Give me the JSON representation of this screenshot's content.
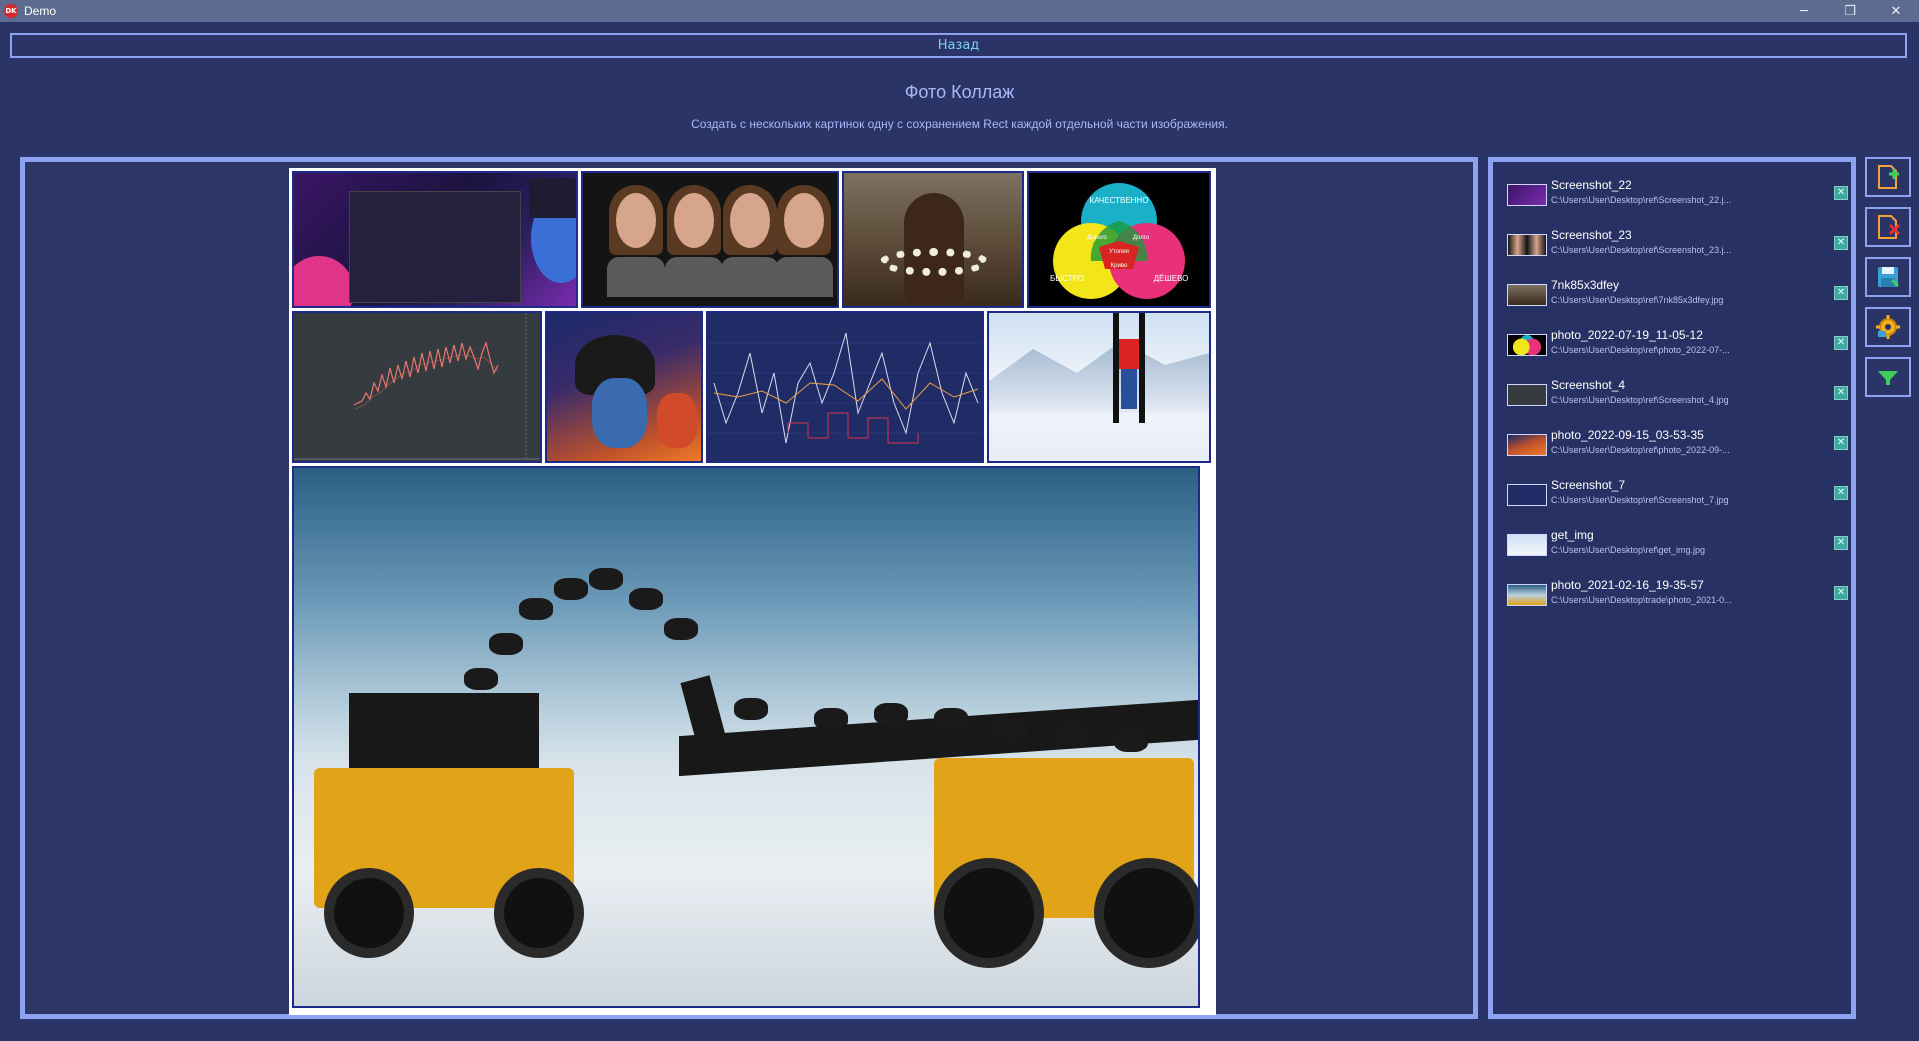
{
  "window": {
    "app_icon_text": "DK",
    "title": "Demo",
    "controls": {
      "minimize": "─",
      "restore": "❐",
      "close": "✕"
    }
  },
  "toolbar": {
    "back_label": "Назад"
  },
  "header": {
    "title": "Фото Коллаж",
    "subtitle": "Создать с нескольких картинок одну с сохранением Rect каждой отдельной части изображения."
  },
  "collage": {
    "tiles": [
      {
        "name": "Screenshot_22"
      },
      {
        "name": "Screenshot_23"
      },
      {
        "name": "7nk85x3dfey"
      },
      {
        "name": "photo_2022-07-19_11-05-12"
      },
      {
        "name": "Screenshot_4"
      },
      {
        "name": "photo_2022-09-15_03-53-35"
      },
      {
        "name": "Screenshot_7"
      },
      {
        "name": "get_img"
      },
      {
        "name": "photo_2021-02-16_19-35-57"
      }
    ],
    "venn_labels": {
      "top": "КАЧЕСТВЕННО",
      "left": "БЫСТРО",
      "right": "ДЁШЕВО",
      "lt": "Дорого",
      "rt": "Долго",
      "center_top": "Утопия",
      "center_bottom": "Криво"
    }
  },
  "file_list": {
    "items": [
      {
        "name": "Screenshot_22",
        "path": "C:\\Users\\User\\Desktop\\ref\\Screenshot_22.j...",
        "remove": "✕"
      },
      {
        "name": "Screenshot_23",
        "path": "C:\\Users\\User\\Desktop\\ref\\Screenshot_23.j...",
        "remove": "✕"
      },
      {
        "name": "7nk85x3dfey",
        "path": "C:\\Users\\User\\Desktop\\ref\\7nk85x3dfey.jpg",
        "remove": "✕"
      },
      {
        "name": "photo_2022-07-19_11-05-12",
        "path": "C:\\Users\\User\\Desktop\\ref\\photo_2022-07-...",
        "remove": "✕"
      },
      {
        "name": "Screenshot_4",
        "path": "C:\\Users\\User\\Desktop\\ref\\Screenshot_4.jpg",
        "remove": "✕"
      },
      {
        "name": "photo_2022-09-15_03-53-35",
        "path": "C:\\Users\\User\\Desktop\\ref\\photo_2022-09-...",
        "remove": "✕"
      },
      {
        "name": "Screenshot_7",
        "path": "C:\\Users\\User\\Desktop\\ref\\Screenshot_7.jpg",
        "remove": "✕"
      },
      {
        "name": "get_img",
        "path": "C:\\Users\\User\\Desktop\\ref\\get_img.jpg",
        "remove": "✕"
      },
      {
        "name": "photo_2021-02-16_19-35-57",
        "path": "C:\\Users\\User\\Desktop\\trade\\photo_2021-0...",
        "remove": "✕"
      }
    ]
  },
  "tools": [
    {
      "icon": "add-file-icon"
    },
    {
      "icon": "remove-file-icon"
    },
    {
      "icon": "save-icon"
    },
    {
      "icon": "settings-gear-icon"
    },
    {
      "icon": "filter-icon"
    }
  ],
  "colors": {
    "background": "#2b3466",
    "panel_border": "#8da3f0",
    "titlebar": "#5c6b8f",
    "accent_text": "#79d3ff",
    "remove_button": "#3ea9a0"
  }
}
